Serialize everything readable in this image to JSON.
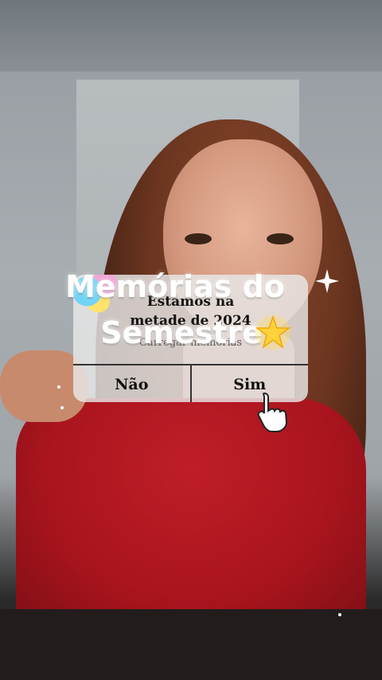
{
  "overlay": {
    "title_line_1": "Memórias do",
    "title_line_2": "Semestre"
  },
  "dialog": {
    "title_line_1": "Estamos na",
    "title_line_2": "metade de 2024",
    "subtitle": "Carregar memórias",
    "no_label": "Não",
    "yes_label": "Sim"
  },
  "icons": {
    "sparkle": "sparkle-icon",
    "star": "glowing-star-icon",
    "pointer": "pointing-hand-icon"
  },
  "colors": {
    "shirt": "#b0161f",
    "dialog_bg": "#e8e8e8",
    "title_text": "#ffffff"
  }
}
